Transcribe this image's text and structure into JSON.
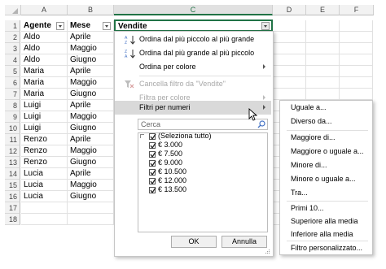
{
  "columns": [
    "A",
    "B",
    "C",
    "D",
    "E",
    "F"
  ],
  "rows": [
    "1",
    "2",
    "3",
    "4",
    "5",
    "6",
    "7",
    "8",
    "9",
    "10",
    "11",
    "12",
    "13",
    "14",
    "15",
    "16",
    "17",
    "18"
  ],
  "headers": {
    "agente": "Agente",
    "mese": "Mese",
    "vendite": "Vendite"
  },
  "data": [
    {
      "agente": "Aldo",
      "mese": "Aprile"
    },
    {
      "agente": "Aldo",
      "mese": "Maggio"
    },
    {
      "agente": "Aldo",
      "mese": "Giugno"
    },
    {
      "agente": "Maria",
      "mese": "Aprile"
    },
    {
      "agente": "Maria",
      "mese": "Maggio"
    },
    {
      "agente": "Maria",
      "mese": "Giugno"
    },
    {
      "agente": "Luigi",
      "mese": "Aprile"
    },
    {
      "agente": "Luigi",
      "mese": "Maggio"
    },
    {
      "agente": "Luigi",
      "mese": "Giugno"
    },
    {
      "agente": "Renzo",
      "mese": "Aprile"
    },
    {
      "agente": "Renzo",
      "mese": "Maggio"
    },
    {
      "agente": "Renzo",
      "mese": "Giugno"
    },
    {
      "agente": "Lucia",
      "mese": "Aprile"
    },
    {
      "agente": "Lucia",
      "mese": "Maggio"
    },
    {
      "agente": "Lucia",
      "mese": "Giugno"
    }
  ],
  "menu": {
    "sort_asc": "Ordina dal più piccolo al più grande",
    "sort_desc": "Ordina dal più grande al più piccolo",
    "sort_color": "Ordina per colore",
    "clear_filter": "Cancella filtro da \"Vendite\"",
    "filter_color": "Filtra per colore",
    "number_filters": "Filtri per numeri",
    "search_placeholder": "Cerca",
    "list": [
      "(Seleziona tutto)",
      "€ 3.000",
      "€ 7.500",
      "€ 9.000",
      "€ 10.500",
      "€ 12.000",
      "€ 13.500"
    ],
    "ok": "OK",
    "cancel": "Annulla"
  },
  "submenu": {
    "equals": "Uguale a...",
    "not_equals": "Diverso da...",
    "greater": "Maggiore di...",
    "greater_eq": "Maggiore o uguale a...",
    "less": "Minore di...",
    "less_eq": "Minore o uguale a...",
    "between": "Tra...",
    "top10": "Primi 10...",
    "above_avg": "Superiore alla media",
    "below_avg": "Inferiore alla media",
    "custom": "Filtro personalizzato..."
  },
  "colors": {
    "accent": "#217346",
    "sort_icon": "#4472c4"
  }
}
